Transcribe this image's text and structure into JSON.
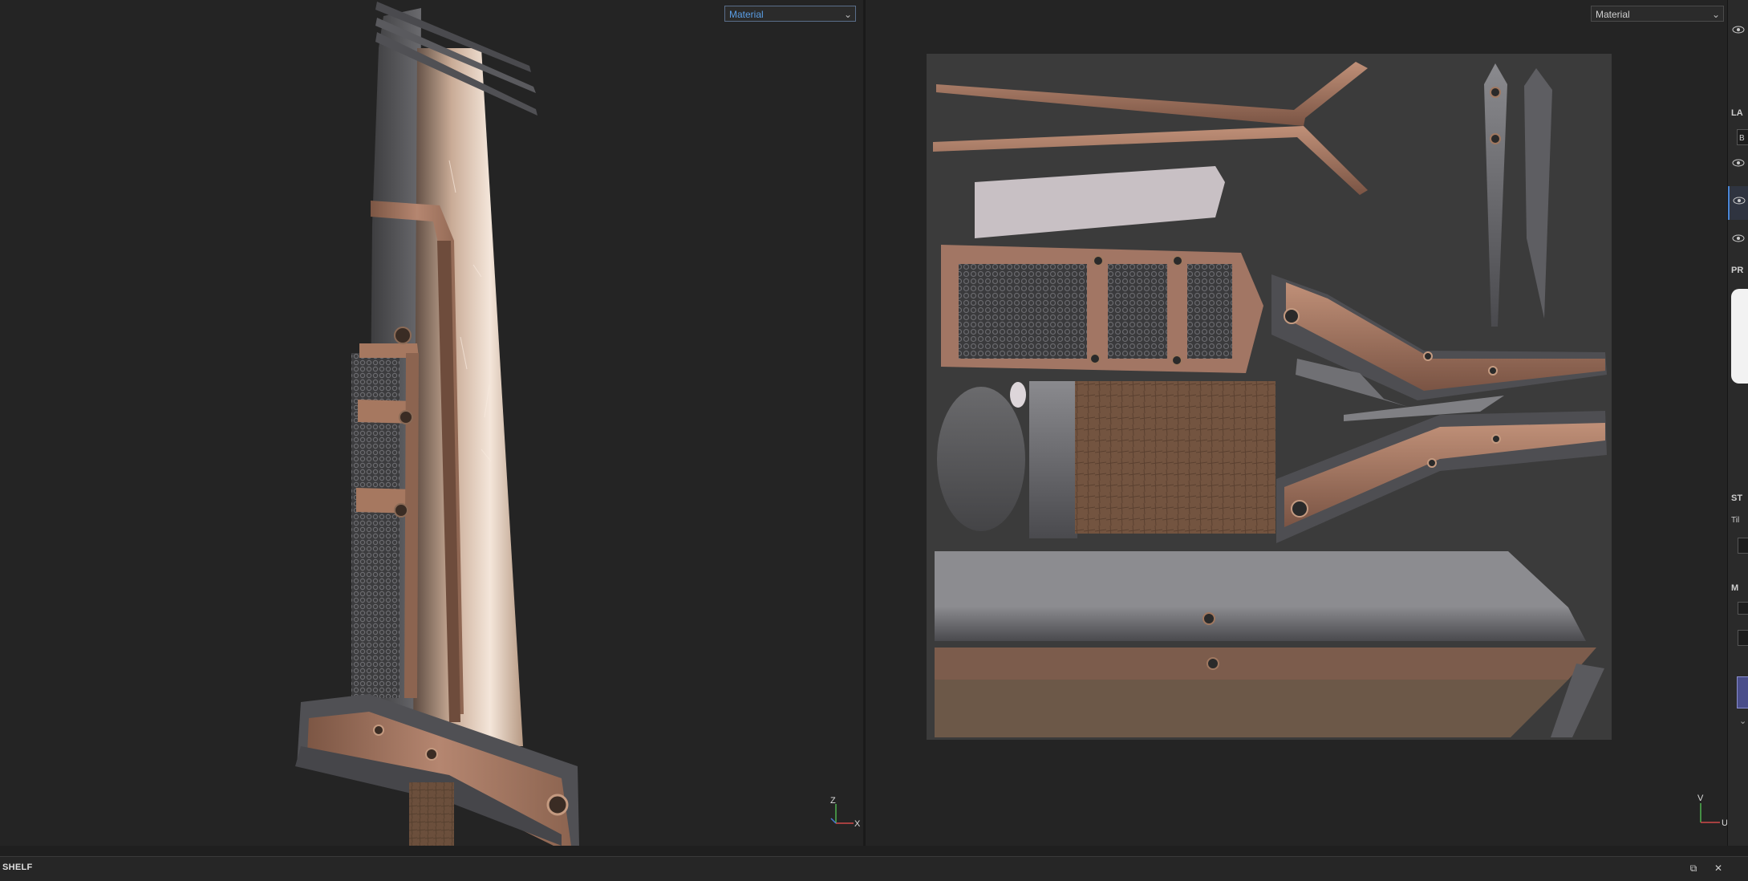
{
  "viewport_3d": {
    "material_dropdown": "Material",
    "axis_labels": {
      "up": "Z",
      "right": "X"
    }
  },
  "viewport_2d": {
    "material_dropdown": "Material",
    "axis_labels": {
      "up": "V",
      "right": "U"
    }
  },
  "right_panel": {
    "labels": [
      "LA",
      "B",
      "PR",
      "ST",
      "Til",
      "M"
    ]
  },
  "shelf": {
    "title": "SHELF",
    "undock_icon": "undock-icon",
    "close_icon": "close-icon"
  },
  "colors": {
    "background": "#242424",
    "accent": "#5a9ee6",
    "copper": "#a67860",
    "steel": "#6e6e72"
  }
}
